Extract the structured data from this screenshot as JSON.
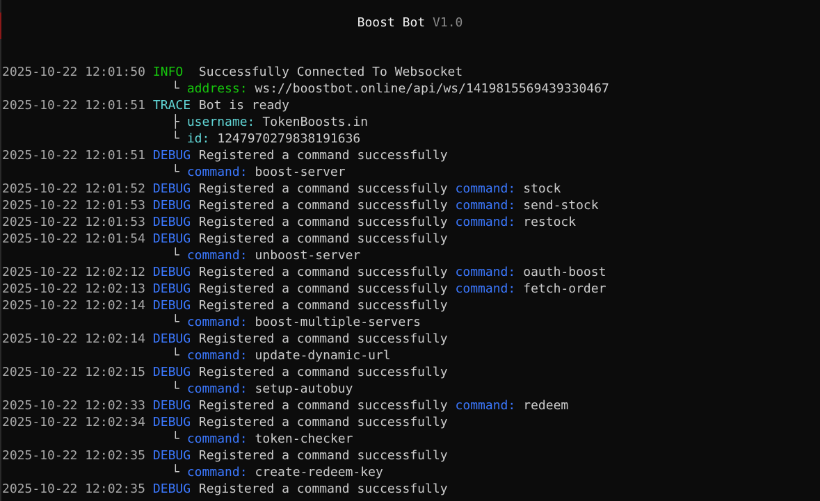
{
  "window": {
    "title": "Boost Bot",
    "version": "V1.0"
  },
  "log": [
    {
      "kind": "entry",
      "ts": "2025-10-22 12:01:50",
      "level": "INFO",
      "message": "Successfully Connected To Websocket"
    },
    {
      "kind": "field",
      "branch": "└",
      "level": "INFO",
      "key": "address:",
      "value": "ws://boostbot.online/api/ws/1419815569439330467"
    },
    {
      "kind": "entry",
      "ts": "2025-10-22 12:01:51",
      "level": "TRACE",
      "message": "Bot is ready"
    },
    {
      "kind": "field",
      "branch": "├",
      "level": "TRACE",
      "key": "username:",
      "value": "TokenBoosts.in"
    },
    {
      "kind": "field",
      "branch": "└",
      "level": "TRACE",
      "key": "id:",
      "value": "1247970279838191636"
    },
    {
      "kind": "entry",
      "ts": "2025-10-22 12:01:51",
      "level": "DEBUG",
      "message": "Registered a command successfully"
    },
    {
      "kind": "field",
      "branch": "└",
      "level": "DEBUG",
      "key": "command:",
      "value": "boost-server"
    },
    {
      "kind": "entry",
      "ts": "2025-10-22 12:01:52",
      "level": "DEBUG",
      "message": "Registered a command successfully",
      "key": "command:",
      "value": "stock"
    },
    {
      "kind": "entry",
      "ts": "2025-10-22 12:01:53",
      "level": "DEBUG",
      "message": "Registered a command successfully",
      "key": "command:",
      "value": "send-stock"
    },
    {
      "kind": "entry",
      "ts": "2025-10-22 12:01:53",
      "level": "DEBUG",
      "message": "Registered a command successfully",
      "key": "command:",
      "value": "restock"
    },
    {
      "kind": "entry",
      "ts": "2025-10-22 12:01:54",
      "level": "DEBUG",
      "message": "Registered a command successfully"
    },
    {
      "kind": "field",
      "branch": "└",
      "level": "DEBUG",
      "key": "command:",
      "value": "unboost-server"
    },
    {
      "kind": "entry",
      "ts": "2025-10-22 12:02:12",
      "level": "DEBUG",
      "message": "Registered a command successfully",
      "key": "command:",
      "value": "oauth-boost"
    },
    {
      "kind": "entry",
      "ts": "2025-10-22 12:02:13",
      "level": "DEBUG",
      "message": "Registered a command successfully",
      "key": "command:",
      "value": "fetch-order"
    },
    {
      "kind": "entry",
      "ts": "2025-10-22 12:02:14",
      "level": "DEBUG",
      "message": "Registered a command successfully"
    },
    {
      "kind": "field",
      "branch": "└",
      "level": "DEBUG",
      "key": "command:",
      "value": "boost-multiple-servers"
    },
    {
      "kind": "entry",
      "ts": "2025-10-22 12:02:14",
      "level": "DEBUG",
      "message": "Registered a command successfully"
    },
    {
      "kind": "field",
      "branch": "└",
      "level": "DEBUG",
      "key": "command:",
      "value": "update-dynamic-url"
    },
    {
      "kind": "entry",
      "ts": "2025-10-22 12:02:15",
      "level": "DEBUG",
      "message": "Registered a command successfully"
    },
    {
      "kind": "field",
      "branch": "└",
      "level": "DEBUG",
      "key": "command:",
      "value": "setup-autobuy"
    },
    {
      "kind": "entry",
      "ts": "2025-10-22 12:02:33",
      "level": "DEBUG",
      "message": "Registered a command successfully",
      "key": "command:",
      "value": "redeem"
    },
    {
      "kind": "entry",
      "ts": "2025-10-22 12:02:34",
      "level": "DEBUG",
      "message": "Registered a command successfully"
    },
    {
      "kind": "field",
      "branch": "└",
      "level": "DEBUG",
      "key": "command:",
      "value": "token-checker"
    },
    {
      "kind": "entry",
      "ts": "2025-10-22 12:02:35",
      "level": "DEBUG",
      "message": "Registered a command successfully"
    },
    {
      "kind": "field",
      "branch": "└",
      "level": "DEBUG",
      "key": "command:",
      "value": "create-redeem-key"
    },
    {
      "kind": "entry",
      "ts": "2025-10-22 12:02:35",
      "level": "DEBUG",
      "message": "Registered a command successfully"
    }
  ]
}
